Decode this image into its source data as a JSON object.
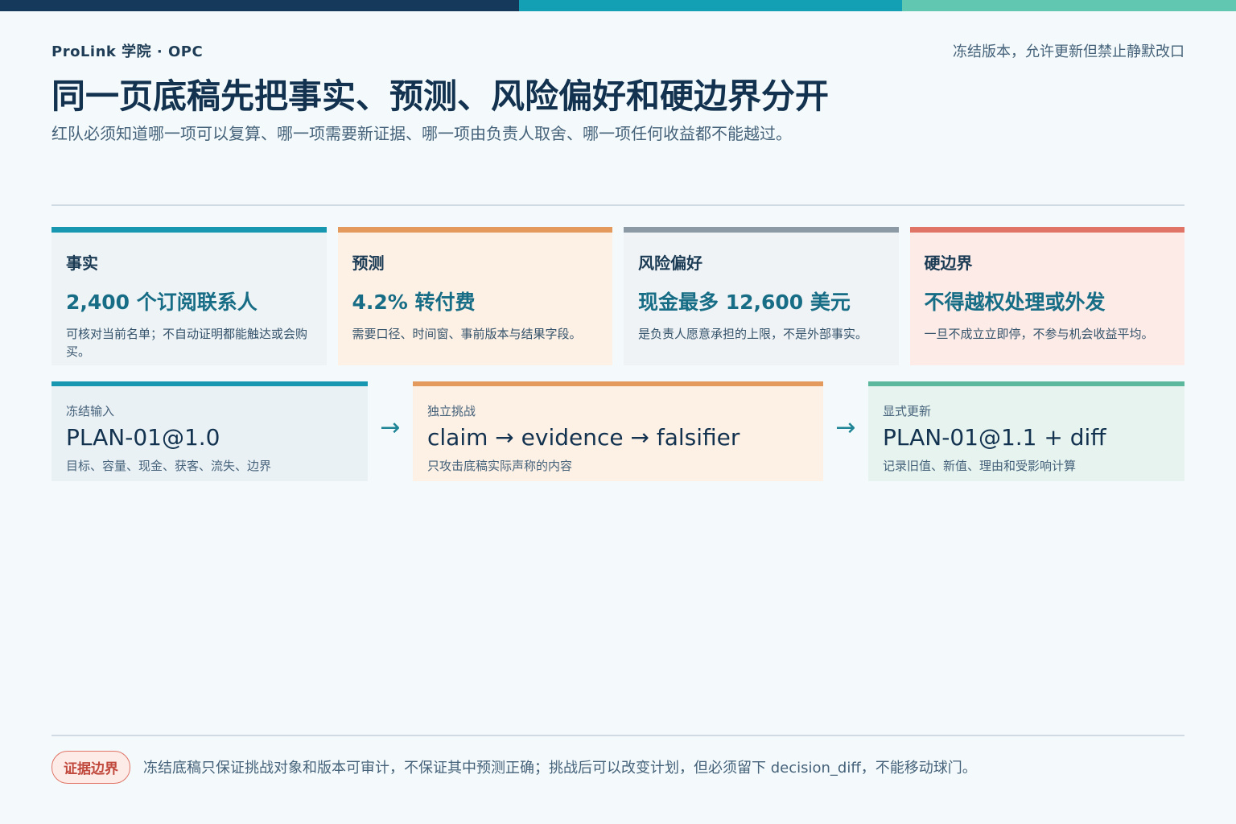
{
  "header": {
    "brand": "ProLink 学院 · OPC",
    "note": "冻结版本，允许更新但禁止静默改口",
    "title": "同一页底稿先把事实、预测、风险偏好和硬边界分开",
    "subtitle": "红队必须知道哪一项可以复算、哪一项需要新证据、哪一项由负责人取舍、哪一项任何收益都不能越过。"
  },
  "cards": [
    {
      "label": "事实",
      "value": "2,400 个订阅联系人",
      "desc": "可核对当前名单；不自动证明都能触达或会购买。",
      "accent": "#1897b0"
    },
    {
      "label": "预测",
      "value": "4.2% 转付费",
      "desc": "需要口径、时间窗、事前版本与结果字段。",
      "accent": "#e49a5c"
    },
    {
      "label": "风险偏好",
      "value": "现金最多 12,600 美元",
      "desc": "是负责人愿意承担的上限，不是外部事实。",
      "accent": "#8b9aa5"
    },
    {
      "label": "硬边界",
      "value": "不得越权处理或外发",
      "desc": "一旦不成立立即停，不参与机会收益平均。",
      "accent": "#e07467"
    }
  ],
  "flow": [
    {
      "small": "冻结输入",
      "big": "PLAN-01@1.0",
      "sub": "目标、容量、现金、获客、流失、边界"
    },
    {
      "small": "独立挑战",
      "big": "claim → evidence → falsifier",
      "sub": "只攻击底稿实际声称的内容"
    },
    {
      "small": "显式更新",
      "big": "PLAN-01@1.1 + diff",
      "sub": "记录旧值、新值、理由和受影响计算"
    }
  ],
  "arrow": "→",
  "footer": {
    "badge": "证据边界",
    "text": "冻结底稿只保证挑战对象和版本可审计，不保证其中预测正确；挑战后可以改变计划，但必须留下 decision_diff，不能移动球门。"
  }
}
